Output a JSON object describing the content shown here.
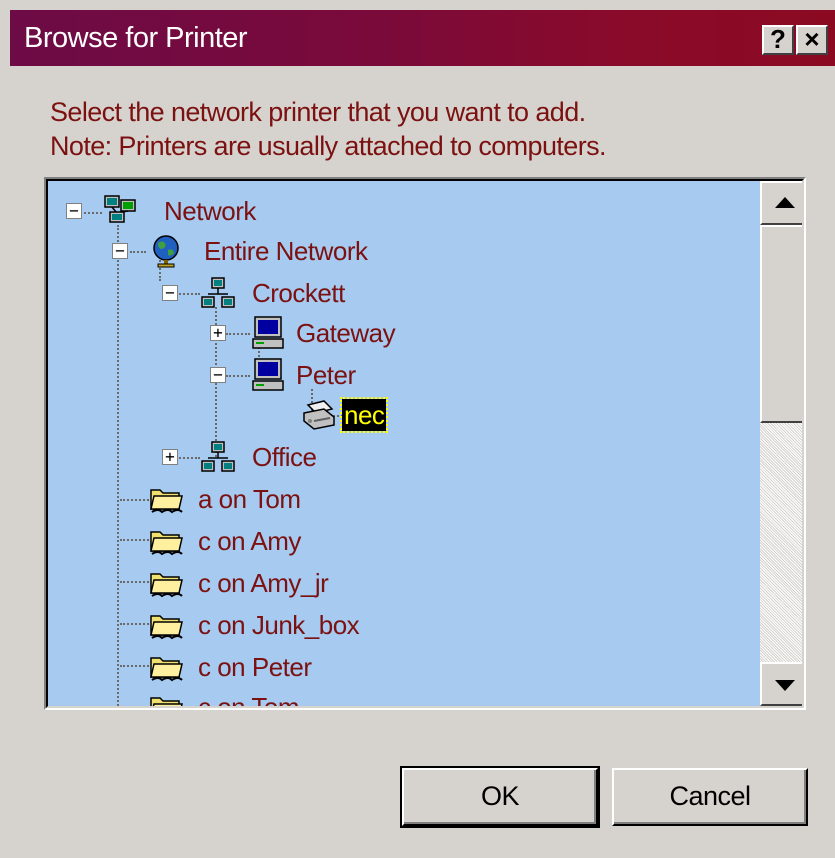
{
  "window": {
    "title": "Browse for Printer",
    "help_label": "?",
    "close_label": "×"
  },
  "instructions": {
    "line1": "Select the network printer that you want to add.",
    "line2": "Note: Printers are usually attached to computers."
  },
  "tree": {
    "items": [
      {
        "label": "Network",
        "icon": "network-icon",
        "expander": "−",
        "level": 0
      },
      {
        "label": "Entire Network",
        "icon": "globe-icon",
        "expander": "−",
        "level": 1
      },
      {
        "label": "Crockett",
        "icon": "workgroup-icon",
        "expander": "−",
        "level": 2
      },
      {
        "label": "Gateway",
        "icon": "computer-icon",
        "expander": "+",
        "level": 3
      },
      {
        "label": "Peter",
        "icon": "computer-icon",
        "expander": "−",
        "level": 3
      },
      {
        "label": "nec",
        "icon": "printer-icon",
        "expander": "",
        "level": 4,
        "selected": true
      },
      {
        "label": "Office",
        "icon": "workgroup-icon",
        "expander": "+",
        "level": 2
      },
      {
        "label": "a on Tom",
        "icon": "shared-folder-icon",
        "expander": "",
        "level": 1
      },
      {
        "label": "c on Amy",
        "icon": "shared-folder-icon",
        "expander": "",
        "level": 1
      },
      {
        "label": "c on Amy_jr",
        "icon": "shared-folder-icon",
        "expander": "",
        "level": 1
      },
      {
        "label": "c on Junk_box",
        "icon": "shared-folder-icon",
        "expander": "",
        "level": 1
      },
      {
        "label": "c on Peter",
        "icon": "shared-folder-icon",
        "expander": "",
        "level": 1
      },
      {
        "label": "c on Tom",
        "icon": "shared-folder-icon",
        "expander": "",
        "level": 1
      }
    ]
  },
  "buttons": {
    "ok": "OK",
    "cancel": "Cancel"
  },
  "colors": {
    "title_bar_left": "#6d0b46",
    "title_bar_right": "#8b0a22",
    "tree_background": "#a6caf0",
    "text": "#7b1111",
    "selection_bg": "#000000",
    "selection_text": "#ffff00"
  }
}
